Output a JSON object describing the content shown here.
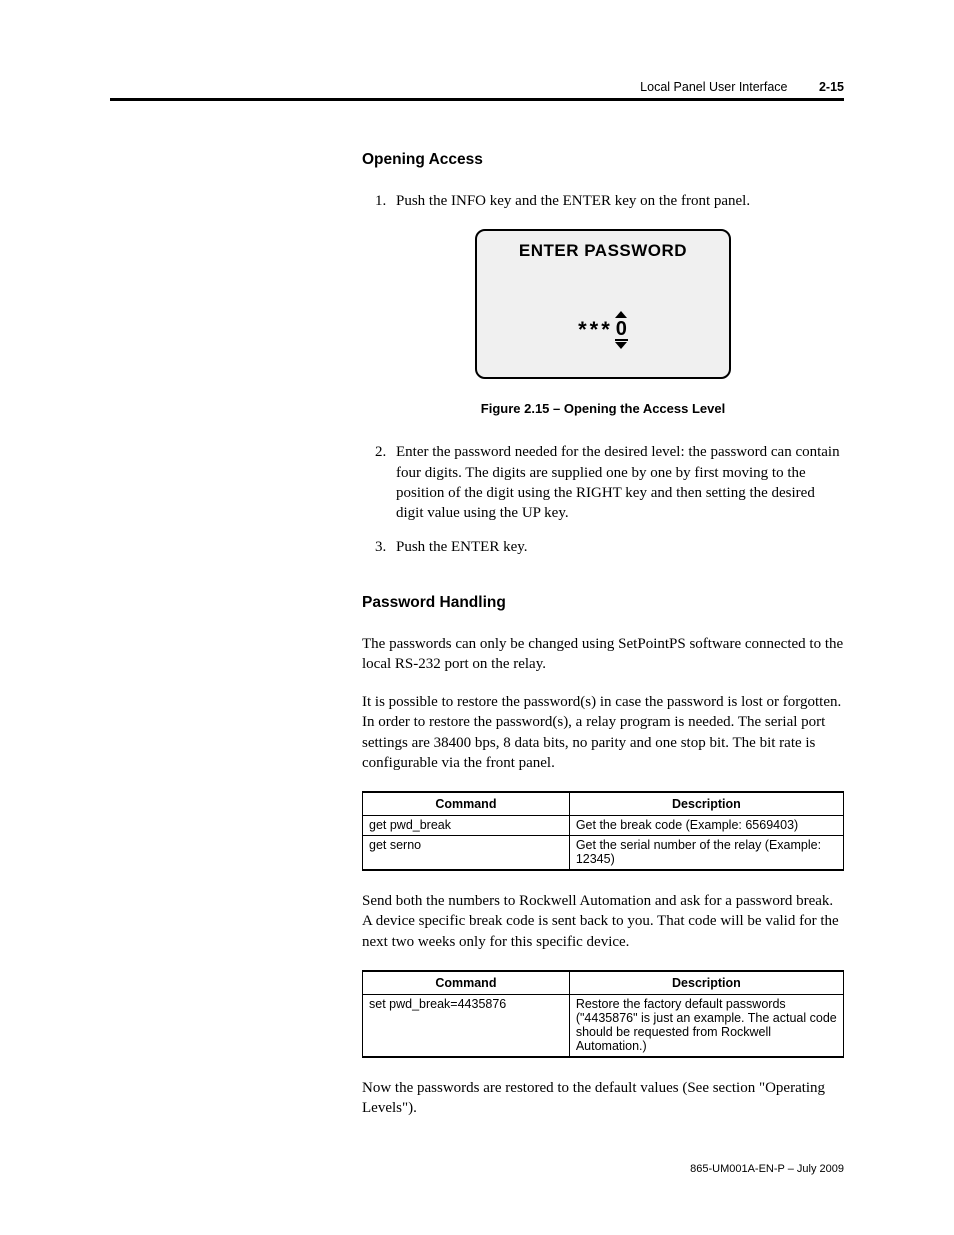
{
  "header": {
    "title": "Local Panel User Interface",
    "pageno": "2-15"
  },
  "section1": {
    "heading": "Opening Access",
    "step1": "Push the INFO key and the ENTER key on the front panel.",
    "panel": {
      "title": "ENTER PASSWORD",
      "masked": "***",
      "active_digit": "0"
    },
    "figure_caption": "Figure 2.15 – Opening the Access Level",
    "step2": "Enter the password needed for the desired level: the password can contain four digits. The digits are supplied one by one by first moving to the position of the digit using the RIGHT key and then setting the desired digit value using the UP key.",
    "step3": "Push the ENTER key."
  },
  "section2": {
    "heading": "Password Handling",
    "para1": "The passwords can only be changed using SetPointPS software connected to the local RS-232 port on the relay.",
    "para2": "It is possible to restore the password(s) in case the password is lost or forgotten. In order to restore the password(s), a relay program is needed. The serial port settings are 38400 bps, 8 data bits, no parity and one stop bit.  The bit rate is configurable via the front panel.",
    "table1": {
      "headers": {
        "c1": "Command",
        "c2": "Description"
      },
      "rows": [
        {
          "cmd": "get pwd_break",
          "desc": "Get the break code (Example: 6569403)"
        },
        {
          "cmd": "get serno",
          "desc": "Get the serial number of the relay (Example: 12345)"
        }
      ]
    },
    "para3": "Send both the numbers to Rockwell Automation and ask for a password break. A device specific break code is sent back to you. That code will be valid for the next two weeks only for this specific device.",
    "table2": {
      "headers": {
        "c1": "Command",
        "c2": "Description"
      },
      "rows": [
        {
          "cmd": "set pwd_break=4435876",
          "desc": "Restore the factory default passwords (\"4435876\" is just an example. The actual code should be requested from Rockwell Automation.)"
        }
      ]
    },
    "para4": "Now the passwords are restored to the default values (See section \"Operating Levels\")."
  },
  "footer": "865-UM001A-EN-P – July 2009"
}
